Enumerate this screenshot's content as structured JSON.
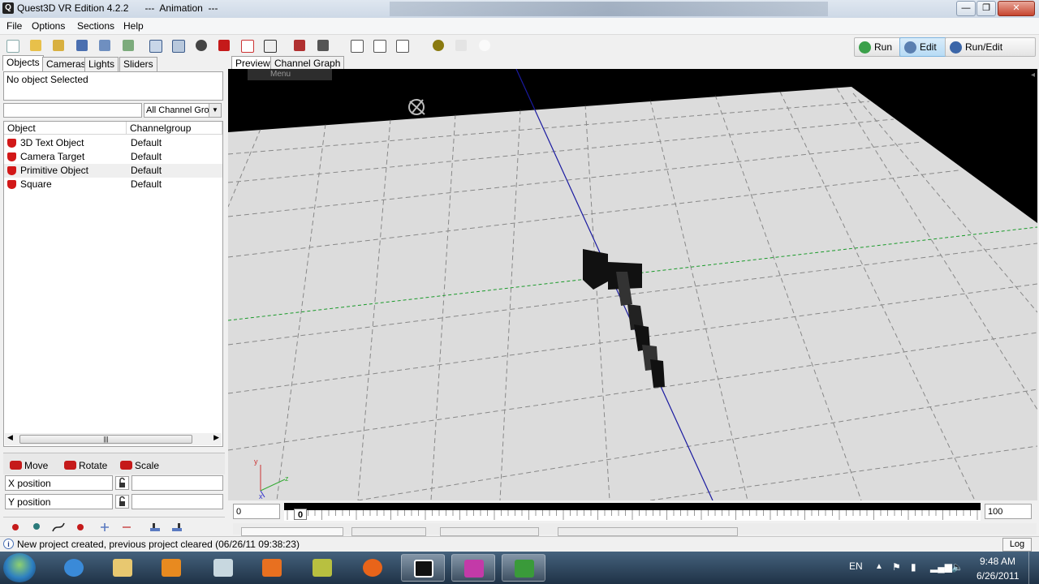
{
  "window": {
    "app_title": "Quest3D VR Edition 4.2.2",
    "doc_title": "---  Animation  ---",
    "minimize": "—",
    "maximize": "❐",
    "close": "✕"
  },
  "menubar": {
    "items": [
      "File",
      "Options",
      "Sections",
      "Help"
    ]
  },
  "toolbar": {
    "run_label": "Run",
    "edit_label": "Edit",
    "runedit_label": "Run/Edit"
  },
  "left_panel": {
    "tabs": [
      "Objects",
      "Cameras",
      "Lights",
      "Sliders"
    ],
    "status_text": "No object Selected",
    "filter_placeholder": "",
    "channel_group_select": "All Channel Grou",
    "list": {
      "columns": [
        "Object",
        "Channelgroup"
      ],
      "rows": [
        {
          "name": "3D Text Object",
          "group": "Default"
        },
        {
          "name": "Camera Target",
          "group": "Default"
        },
        {
          "name": "Primitive Object",
          "group": "Default"
        },
        {
          "name": "Square",
          "group": "Default"
        }
      ]
    },
    "transform": {
      "move": "Move",
      "rotate": "Rotate",
      "scale": "Scale",
      "x_label": "X position",
      "y_label": "Y position"
    }
  },
  "viewport": {
    "tabs": [
      "Preview",
      "Channel Graph"
    ],
    "overlay_menu": "Menu",
    "axis": {
      "x": "x",
      "y": "y",
      "z": "z"
    }
  },
  "timeline": {
    "start": "0",
    "current": "0",
    "end": "100"
  },
  "statusbar": {
    "message": "New project created, previous project cleared (06/26/11 09:38:23)",
    "log_button": "Log",
    "info_icon": "i"
  },
  "taskbar": {
    "language": "EN",
    "time": "9:48 AM",
    "date": "6/26/2011"
  },
  "colors": {
    "grid_floor": "#dcdcdc",
    "accent_red": "#d21818",
    "taskbar": "#2a4158"
  }
}
